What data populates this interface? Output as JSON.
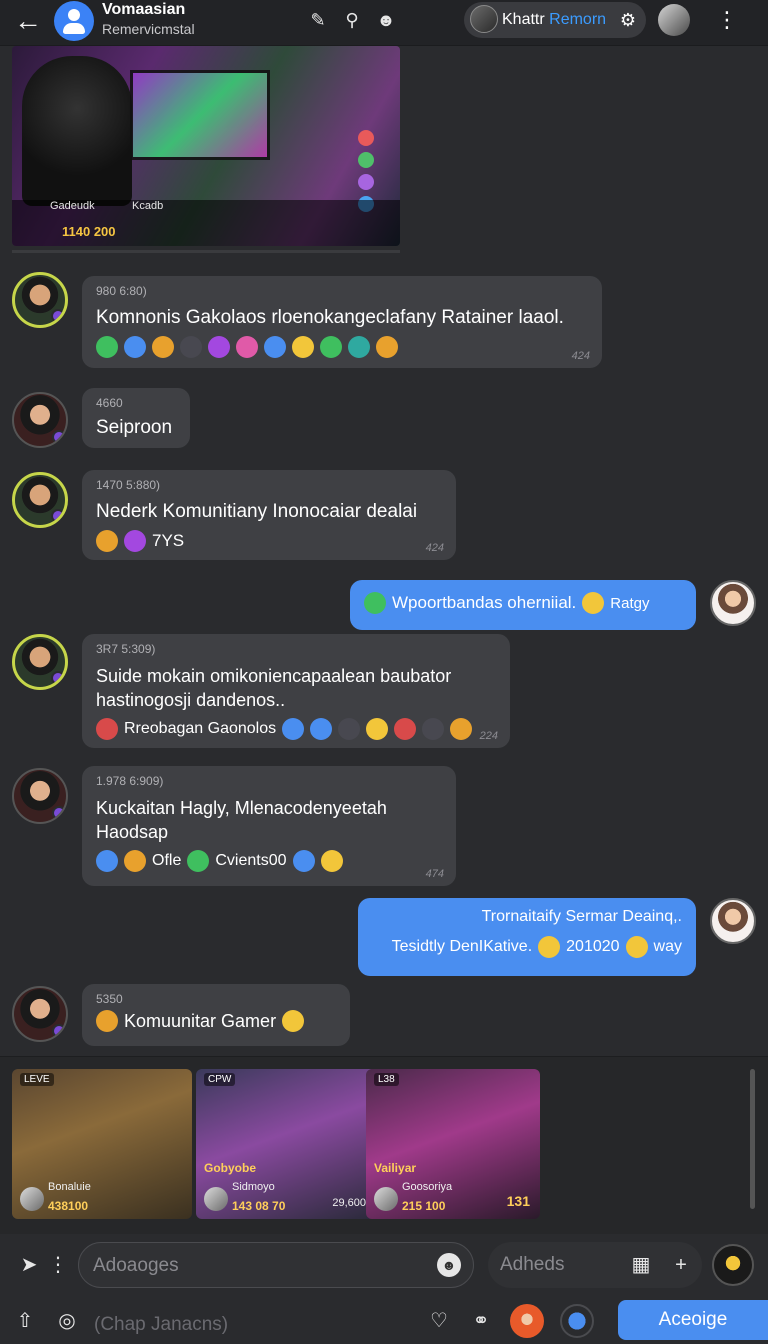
{
  "header": {
    "title": "Vomaasian",
    "subtitle": "Remervicmstal",
    "profile_name": "Khattr",
    "profile_accent": "Remorn"
  },
  "media_top": {
    "label_left": "Gadeudk",
    "label_right": "Kcadb",
    "score": "1140 200"
  },
  "messages": [
    {
      "meta": "980 6:80)",
      "text": "Komnonis Gakolaos rloenokangeclafany Ratainer laaol.",
      "stamp": "424"
    },
    {
      "meta": "4660",
      "text": "Seiproon"
    },
    {
      "meta": "1470 5:880)",
      "text": "Nederk Komunitiany Inonocaiar dealai",
      "inline": "7YS",
      "stamp": "424"
    },
    {
      "text": "Wpoortbandas oherniial.",
      "trail": "Ratgy"
    },
    {
      "meta": "3R7 5:309)",
      "text": "Suide mokain omikoniencapaalean baubator hastinogosji dandenos..",
      "inline": "Rreobagan Gaonolos",
      "stamp": "224"
    },
    {
      "meta": "1.978 6:909)",
      "text": "Kuckaitan Hagly, Mlenacodenyeetah Haodsap",
      "inline1": "Ofle",
      "inline2": "Cvients00",
      "stamp": "474"
    },
    {
      "line1": "Trornaitaify Sermar Deainq,.",
      "line2a": "Tesidtly DenIKative.",
      "line2b": "201020",
      "line2c": "way"
    },
    {
      "meta": "5350",
      "text": "Komuunitar Gamer"
    }
  ],
  "gallery": [
    {
      "tag": "LEVE",
      "title": "",
      "sub": "Bonaluie",
      "price": "438100",
      "extra": ""
    },
    {
      "tag": "CPW",
      "title": "Gobyobe",
      "sub": "Sidmoyo",
      "price": "143 08 70",
      "extra": "29,600"
    },
    {
      "tag": "L38",
      "title": "Vailiyar",
      "sub": "Goosoriya",
      "price": "215 100",
      "extra": "131"
    }
  ],
  "composer": {
    "placeholder_main": "Adoaoges",
    "placeholder_side": "Adheds",
    "hint": "(Chap Janacns)",
    "button_label": "Aceoige"
  }
}
